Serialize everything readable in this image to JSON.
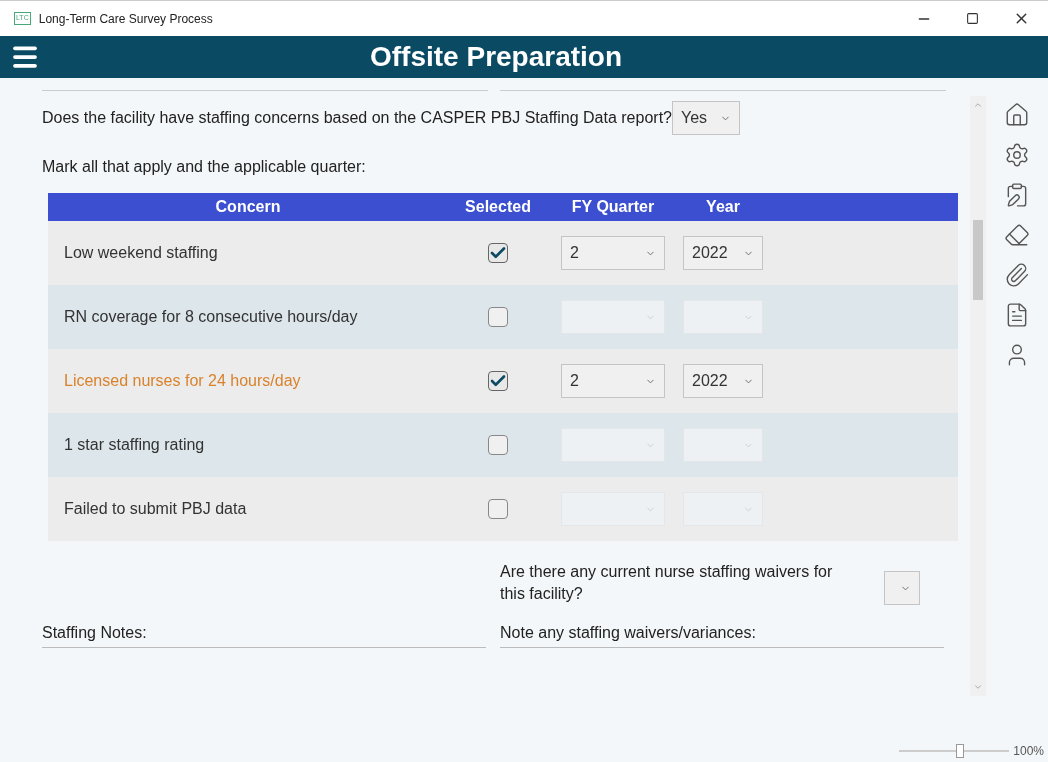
{
  "window": {
    "app_badge": "LTC",
    "title": "Long-Term Care Survey Process"
  },
  "header": {
    "title": "Offsite Preparation"
  },
  "staffing_question": {
    "label": "Does the facility have staffing concerns based on the CASPER PBJ Staffing Data report?",
    "value": "Yes"
  },
  "instruction": "Mark all that apply and the applicable quarter:",
  "table": {
    "columns": [
      "Concern",
      "Selected",
      "FY Quarter",
      "Year"
    ],
    "rows": [
      {
        "concern": "Low weekend staffing",
        "checked": true,
        "highlighted": false,
        "quarter": "2",
        "year": "2022"
      },
      {
        "concern": "RN coverage for 8 consecutive hours/day",
        "checked": false,
        "highlighted": false
      },
      {
        "concern": "Licensed nurses for 24 hours/day",
        "checked": true,
        "highlighted": true,
        "quarter": "2",
        "year": "2022"
      },
      {
        "concern": "1 star staffing rating",
        "checked": false,
        "highlighted": false
      },
      {
        "concern": "Failed to submit PBJ data",
        "checked": false,
        "highlighted": false
      }
    ]
  },
  "waiver_question": {
    "label": "Are there any current nurse staffing waivers for this facility?"
  },
  "notes": [
    {
      "label": "Staffing Notes:"
    },
    {
      "label": "Note any staffing waivers/variances:"
    }
  ],
  "zoom": {
    "level": 0.55,
    "reading": "100%"
  }
}
